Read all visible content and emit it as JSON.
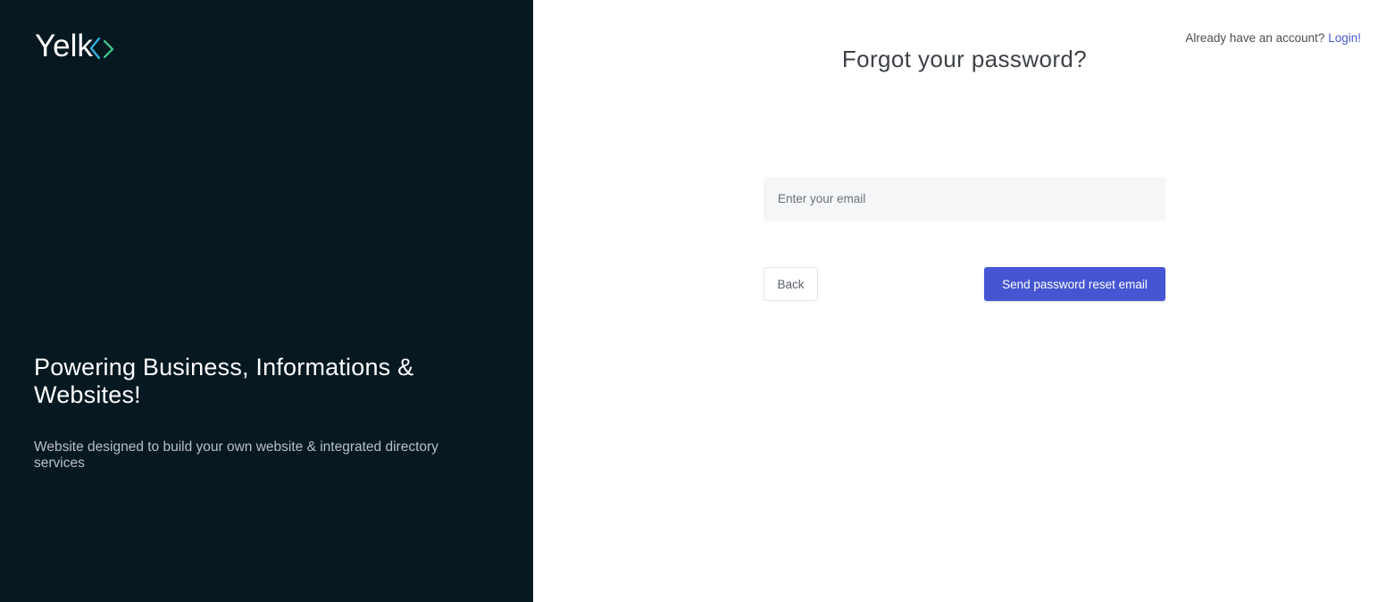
{
  "brand": {
    "logo_text": "Yelk",
    "colors": {
      "panel_bg": "#061820",
      "accent": "#4656d3",
      "link": "#4557d6",
      "logo_chevron_left": "#2fb7e8",
      "logo_chevron_right": "#3ccf8e"
    }
  },
  "hero": {
    "title": "Powering Business, Informations & Websites!",
    "subtitle": "Website designed to build your own website & integrated directory services"
  },
  "header": {
    "account_prompt": "Already have an account?",
    "login_link": "Login!"
  },
  "form": {
    "title": "Forgot your password?",
    "email": {
      "value": "",
      "placeholder": "Enter your email"
    },
    "back_label": "Back",
    "submit_label": "Send password reset email"
  }
}
